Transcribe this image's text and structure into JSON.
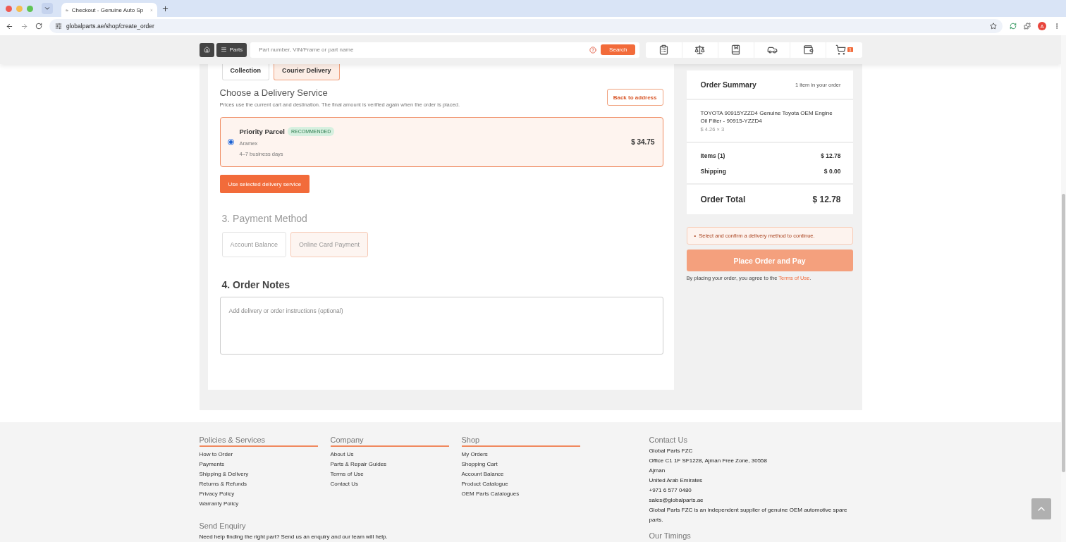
{
  "browser": {
    "tab_title": "Checkout - Genuine Auto Sp",
    "url": "globalparts.ae/shop/create_order",
    "profile_initial": "A"
  },
  "header": {
    "menu_label": "Parts",
    "search_placeholder": "Part number, VIN/Frame or part name",
    "search_button": "Search",
    "cart_count": "1"
  },
  "delivery": {
    "methods": [
      {
        "label": "Collection",
        "selected": false
      },
      {
        "label": "Courier Delivery",
        "selected": true
      }
    ],
    "title": "Choose a Delivery Service",
    "subtitle": "Prices use the current cart and destination. The final amount is verified again when the order is placed.",
    "back_button": "Back to address",
    "services": [
      {
        "name": "Priority Parcel",
        "badge": "RECOMMENDED",
        "carrier": "Aramex",
        "eta": "4–7 business days",
        "price": "$ 34.75",
        "selected": true
      }
    ],
    "confirm_button": "Use selected delivery service"
  },
  "payment": {
    "title": "3. Payment Method",
    "disabled": true,
    "options": [
      {
        "label": "Account Balance",
        "selected": false
      },
      {
        "label": "Online Card Payment",
        "selected": true
      }
    ]
  },
  "notes": {
    "title": "4. Order Notes",
    "placeholder": "Add delivery or order instructions (optional)"
  },
  "summary": {
    "title": "Order Summary",
    "count": "1 item in your order",
    "items": [
      {
        "name": "TOYOTA 90915YZZD4 Genuine Toyota OEM Engine Oil Filter - 90915-YZZD4",
        "price": "$ 4.26 × 3"
      }
    ],
    "lines": [
      {
        "label": "Items (1)",
        "value": "$ 12.78"
      },
      {
        "label": "Shipping",
        "value": "$ 0.00"
      }
    ],
    "total_label": "Order Total",
    "total_value": "$ 12.78",
    "alert_bullet": "•",
    "alert": "Select and confirm a delivery method to continue.",
    "place_button": "Place Order and Pay",
    "place_disabled": true,
    "terms_text": "By placing your order, you agree to the ",
    "terms_link": "Terms of Use",
    "terms_end": "."
  },
  "footer": {
    "columns": [
      {
        "title": "Policies & Services",
        "links": [
          "How to Order",
          "Payments",
          "Shipping & Delivery",
          "Returns & Refunds",
          "Privacy Policy",
          "Warranty Policy"
        ]
      },
      {
        "title": "Company",
        "links": [
          "About Us",
          "Parts & Repair Guides",
          "Terms of Use",
          "Contact Us"
        ]
      },
      {
        "title": "Shop",
        "links": [
          "My Orders",
          "Shopping Cart",
          "Account Balance",
          "Product Catalogue",
          "OEM Parts Catalogues"
        ]
      }
    ],
    "enquiry_title": "Send Enquiry",
    "enquiry_text": "Need help finding the right part? Send us an enquiry and our team will help.",
    "contact_title": "Contact Us",
    "contact_lines": [
      "Global Parts FZC",
      "Office C1 1F SF1228, Ajman Free Zone, 30558",
      "Ajman",
      "United Arab Emirates",
      "+971 6 577 0480",
      "sales@globalparts.ae",
      "Global Parts FZC is an independent supplier of genuine OEM automotive spare parts."
    ],
    "timings_title": "Our Timings"
  }
}
